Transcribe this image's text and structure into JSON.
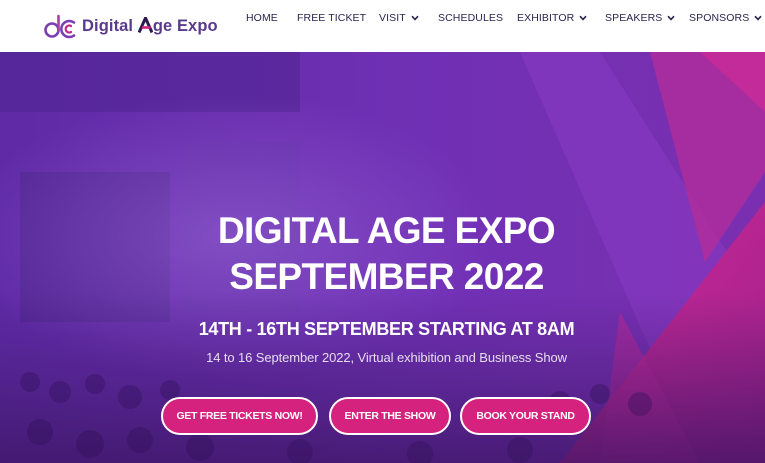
{
  "brand": {
    "name_before": "Digital ",
    "name_after": "ge Expo",
    "logo_letter": "A",
    "colors": {
      "purple": "#5a3a8c",
      "pink": "#d6227f",
      "hero_purple": "#6a2bb0",
      "magenta": "#c0258f"
    }
  },
  "nav": {
    "items": [
      {
        "label": "HOME",
        "has_dropdown": false
      },
      {
        "label": "FREE TICKET",
        "has_dropdown": false
      },
      {
        "label": "VISIT",
        "has_dropdown": true
      },
      {
        "label": "SCHEDULES",
        "has_dropdown": false
      },
      {
        "label": "EXHIBITOR",
        "has_dropdown": true
      },
      {
        "label": "SPEAKERS",
        "has_dropdown": true
      },
      {
        "label": "SPONSORS",
        "has_dropdown": true
      }
    ]
  },
  "hero": {
    "title_line1": "DIGITAL AGE EXPO",
    "title_line2": "SEPTEMBER 2022",
    "date_line": "14TH - 16TH SEPTEMBER STARTING AT 8AM",
    "subtitle": "14 to 16 September 2022, Virtual exhibition and Business Show",
    "buttons": [
      {
        "label": "GET FREE TICKETS NOW!"
      },
      {
        "label": "ENTER THE SHOW"
      },
      {
        "label": "BOOK YOUR STAND"
      }
    ]
  }
}
